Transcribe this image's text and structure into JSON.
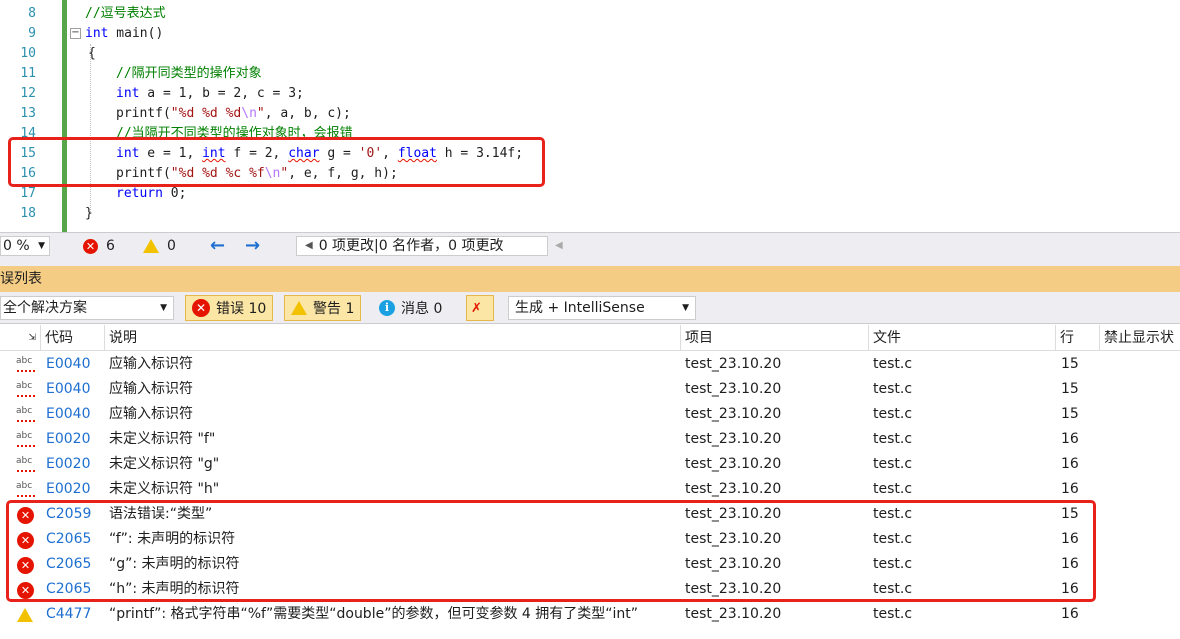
{
  "editor": {
    "lines": [
      {
        "num": "8",
        "text": "//逗号表达式"
      },
      {
        "num": "9",
        "text": "int main()"
      },
      {
        "num": "10",
        "text": "{"
      },
      {
        "num": "11",
        "text": "//隔开同类型的操作对象"
      },
      {
        "num": "12",
        "text": "int a = 1, b = 2, c = 3;"
      },
      {
        "num": "13",
        "text": "printf(\"%d %d %d\\n\", a, b, c);"
      },
      {
        "num": "14",
        "text": "//当隔开不同类型的操作对象时，会报错"
      },
      {
        "num": "15",
        "text": "int e = 1, int f = 2, char g = '0', float h = 3.14f;"
      },
      {
        "num": "16",
        "text": "printf(\"%d %d %c %f\\n\", e, f, g, h);"
      },
      {
        "num": "17",
        "text": "return 0;"
      },
      {
        "num": "18",
        "text": "}"
      }
    ],
    "fold_glyph": "−"
  },
  "statusbar": {
    "zoom": "0 %",
    "errors": "6",
    "warnings": "0",
    "changes": "0 项更改|0 名作者，0 项更改"
  },
  "panel": {
    "title": "误列表",
    "scope": "全个解决方案",
    "errors_btn": "错误 10",
    "warnings_btn": "警告 1",
    "messages_btn": "消息 0",
    "build_filter": "生成 + IntelliSense",
    "columns": [
      "代码",
      "说明",
      "项目",
      "文件",
      "行",
      "禁止显示状"
    ]
  },
  "rows": [
    {
      "type": "intellisense",
      "code": "E0040",
      "desc": "应输入标识符",
      "project": "test_23.10.20",
      "file": "test.c",
      "line": "15"
    },
    {
      "type": "intellisense",
      "code": "E0040",
      "desc": "应输入标识符",
      "project": "test_23.10.20",
      "file": "test.c",
      "line": "15"
    },
    {
      "type": "intellisense",
      "code": "E0040",
      "desc": "应输入标识符",
      "project": "test_23.10.20",
      "file": "test.c",
      "line": "15"
    },
    {
      "type": "intellisense",
      "code": "E0020",
      "desc": "未定义标识符 \"f\"",
      "project": "test_23.10.20",
      "file": "test.c",
      "line": "16"
    },
    {
      "type": "intellisense",
      "code": "E0020",
      "desc": "未定义标识符 \"g\"",
      "project": "test_23.10.20",
      "file": "test.c",
      "line": "16"
    },
    {
      "type": "intellisense",
      "code": "E0020",
      "desc": "未定义标识符 \"h\"",
      "project": "test_23.10.20",
      "file": "test.c",
      "line": "16"
    },
    {
      "type": "error",
      "code": "C2059",
      "desc": "语法错误:“类型”",
      "project": "test_23.10.20",
      "file": "test.c",
      "line": "15"
    },
    {
      "type": "error",
      "code": "C2065",
      "desc": "“f”: 未声明的标识符",
      "project": "test_23.10.20",
      "file": "test.c",
      "line": "16"
    },
    {
      "type": "error",
      "code": "C2065",
      "desc": "“g”: 未声明的标识符",
      "project": "test_23.10.20",
      "file": "test.c",
      "line": "16"
    },
    {
      "type": "error",
      "code": "C2065",
      "desc": "“h”: 未声明的标识符",
      "project": "test_23.10.20",
      "file": "test.c",
      "line": "16"
    },
    {
      "type": "warning",
      "code": "C4477",
      "desc": "“printf”: 格式字符串“%f”需要类型“double”的参数，但可变参数 4 拥有了类型“int”",
      "project": "test_23.10.20",
      "file": "test.c",
      "line": "16"
    }
  ],
  "icons": {
    "abc": "abc",
    "error": "✕",
    "info": "i"
  },
  "colors": {
    "accent": "#f5cc84",
    "error": "#e51400",
    "link": "#1e6fd0",
    "highlight": "#e8221b"
  }
}
